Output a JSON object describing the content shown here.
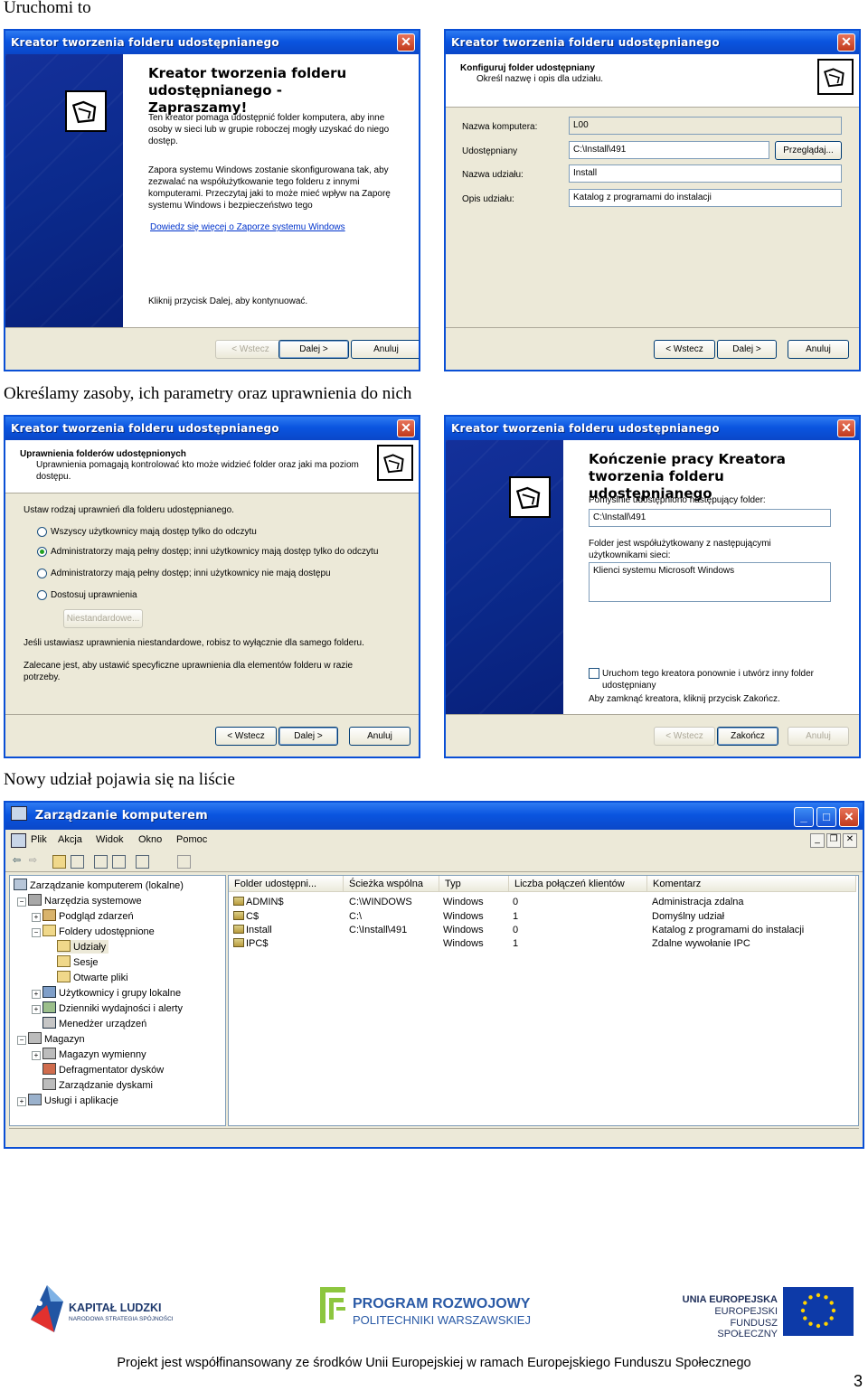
{
  "captions": {
    "c1": "Uruchomi to",
    "c2": "Określamy zasoby, ich parametry oraz uprawnienia do nich",
    "c3": "Nowy udział pojawia się na liście"
  },
  "wizard_title": "Kreator tworzenia folderu udostępnianego",
  "buttons": {
    "back": "< Wstecz",
    "next": "Dalej >",
    "cancel": "Anuluj",
    "finish": "Zakończ",
    "browse": "Przeglądaj..."
  },
  "w1": {
    "heading": "Kreator tworzenia folderu udostępnianego - Zapraszamy!",
    "p1": "Ten kreator pomaga udostępnić folder komputera, aby inne osoby w sieci lub w grupie roboczej mogły uzyskać do niego dostęp.",
    "p2": "Zapora systemu Windows zostanie skonfigurowana tak, aby zezwalać na współużytkowanie tego folderu z innymi komputerami. Przeczytaj jaki to może mieć wpływ na Zaporę systemu Windows i bezpieczeństwo tego",
    "link": "Dowiedz się więcej o Zaporze systemu Windows",
    "p3": "Kliknij przycisk Dalej, aby kontynuować."
  },
  "w2": {
    "header_title": "Konfiguruj folder udostępniany",
    "header_sub": "Określ nazwę i opis dla udziału.",
    "lbl_computer": "Nazwa komputera:",
    "lbl_path": "Udostępniany",
    "lbl_name": "Nazwa udziału:",
    "lbl_desc": "Opis udziału:",
    "val_computer": "L00",
    "val_path": "C:\\Install\\491",
    "val_name": "Install",
    "val_desc": "Katalog z programami do instalacji"
  },
  "w3": {
    "header_title": "Uprawnienia folderów udostępnionych",
    "header_sub": "Uprawnienia pomagają kontrolować kto może widzieć folder oraz jaki ma poziom dostępu.",
    "prompt": "Ustaw rodzaj uprawnień dla folderu udostępnianego.",
    "opt1": "Wszyscy użytkownicy mają dostęp tylko do odczytu",
    "opt2": "Administratorzy mają pełny dostęp; inni użytkownicy mają dostęp tylko do odczytu",
    "opt3": "Administratorzy mają pełny dostęp; inni użytkownicy nie mają dostępu",
    "opt4": "Dostosuj uprawnienia",
    "custom_btn": "Niestandardowe...",
    "note1": "Jeśli ustawiasz uprawnienia niestandardowe, robisz to wyłącznie dla samego folderu.",
    "note2": "Zalecane jest, aby ustawić specyficzne uprawnienia dla elementów folderu w razie potrzeby."
  },
  "w4": {
    "heading": "Kończenie pracy Kreatora tworzenia folderu udostępnianego",
    "lbl1": "Pomyślnie udostępniono następujący folder:",
    "val1": "C:\\Install\\491",
    "lbl2": "Folder jest współużytkowany z następującymi użytkownikami sieci:",
    "val2": "Klienci systemu Microsoft Windows",
    "chk": "Uruchom tego kreatora ponownie i utwórz inny folder udostępniany",
    "close_hint": "Aby zamknąć kreatora, kliknij przycisk Zakończ."
  },
  "mmc": {
    "title": "Zarządzanie komputerem",
    "menus": [
      "Plik",
      "Akcja",
      "Widok",
      "Okno",
      "Pomoc"
    ],
    "tree": [
      "Zarządzanie komputerem (lokalne)",
      "Narzędzia systemowe",
      "Podgląd zdarzeń",
      "Foldery udostępnione",
      "Udziały",
      "Sesje",
      "Otwarte pliki",
      "Użytkownicy i grupy lokalne",
      "Dzienniki wydajności i alerty",
      "Menedżer urządzeń",
      "Magazyn",
      "Magazyn wymienny",
      "Defragmentator dysków",
      "Zarządzanie dyskami",
      "Usługi i aplikacje"
    ],
    "columns": [
      "Folder udostępni...",
      "Ścieżka wspólna",
      "Typ",
      "Liczba połączeń klientów",
      "Komentarz"
    ],
    "rows": [
      [
        "ADMIN$",
        "C:\\WINDOWS",
        "Windows",
        "0",
        "Administracja zdalna"
      ],
      [
        "C$",
        "C:\\",
        "Windows",
        "1",
        "Domyślny udział"
      ],
      [
        "Install",
        "C:\\Install\\491",
        "Windows",
        "0",
        "Katalog z programami do instalacji"
      ],
      [
        "IPC$",
        "",
        "Windows",
        "1",
        "Zdalne wywołanie IPC"
      ]
    ]
  },
  "logos": {
    "kl_title": "KAPITAŁ LUDZKI",
    "kl_sub": "NARODOWA STRATEGIA SPÓJNOŚCI",
    "prpw_1": "PROGRAM ROZWOJOWY",
    "prpw_2": "POLITECHNIKI WARSZAWSKIEJ",
    "ue_1": "UNIA EUROPEJSKA",
    "ue_2": "EUROPEJSKI",
    "ue_3": "FUNDUSZ SPOŁECZNY"
  },
  "footer": "Projekt jest współfinansowany ze środków Unii Europejskiej w ramach Europejskiego Funduszu Społecznego",
  "page_number": "3"
}
